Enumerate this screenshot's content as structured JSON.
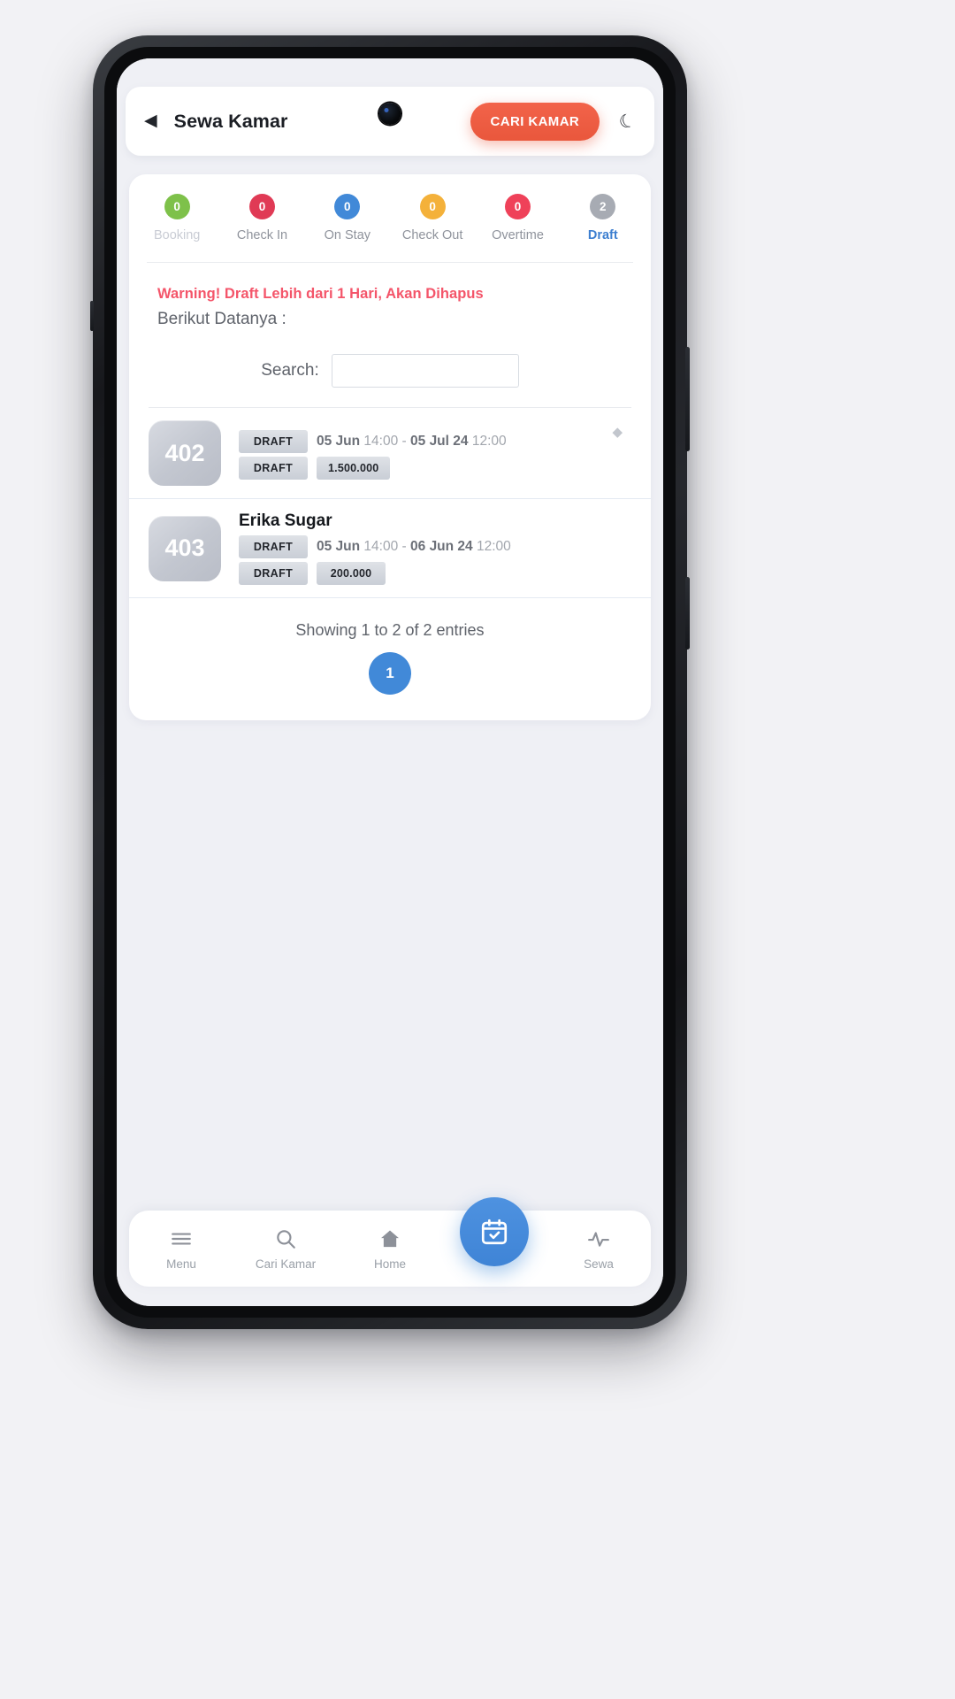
{
  "header": {
    "back_icon": "back-arrow-icon",
    "title": "Sewa Kamar",
    "action_button": "CARI KAMAR",
    "theme_icon": "moon-icon"
  },
  "status_tabs": [
    {
      "label": "Booking",
      "count": "0",
      "color": "#7ec14a",
      "state": "muted"
    },
    {
      "label": "Check In",
      "count": "0",
      "color": "#e03a55",
      "state": "normal"
    },
    {
      "label": "On Stay",
      "count": "0",
      "color": "#4189d8",
      "state": "normal"
    },
    {
      "label": "Check Out",
      "count": "0",
      "color": "#f4b13a",
      "state": "normal"
    },
    {
      "label": "Overtime",
      "count": "0",
      "color": "#ef4159",
      "state": "normal"
    },
    {
      "label": "Draft",
      "count": "2",
      "color": "#a7abb3",
      "state": "active"
    }
  ],
  "notice": {
    "warning": "Warning! Draft Lebih dari 1 Hari, Akan Dihapus",
    "warning_color": "#f4556a",
    "subtitle": "Berikut Datanya :"
  },
  "search": {
    "label": "Search:",
    "value": "",
    "placeholder": ""
  },
  "bookings": [
    {
      "room": "402",
      "guest": "",
      "status_chip": "DRAFT",
      "date_start_day": "05 Jun",
      "date_start_time": "14:00",
      "date_sep": "-",
      "date_end_day": "05 Jul 24",
      "date_end_time": "12:00",
      "payment_chip": "DRAFT",
      "price": "1.500.000"
    },
    {
      "room": "403",
      "guest": "Erika Sugar",
      "status_chip": "DRAFT",
      "date_start_day": "05 Jun",
      "date_start_time": "14:00",
      "date_sep": "-",
      "date_end_day": "06 Jun 24",
      "date_end_time": "12:00",
      "payment_chip": "DRAFT",
      "price": "200.000"
    }
  ],
  "pagination": {
    "entries_text": "Showing 1 to 2 of 2 entries",
    "current_page": "1"
  },
  "bottom_nav": [
    {
      "label": "Menu",
      "icon": "hamburger-menu-icon",
      "active": false
    },
    {
      "label": "Cari Kamar",
      "icon": "search-icon",
      "active": false
    },
    {
      "label": "Home",
      "icon": "home-icon",
      "active": false
    },
    {
      "label": "Jadwal",
      "icon": "calendar-check-icon",
      "active": true
    },
    {
      "label": "Sewa",
      "icon": "activity-pulse-icon",
      "active": false
    }
  ],
  "theme": {
    "accent_orange": "#ec5a3e",
    "accent_blue": "#4189d8",
    "warning_red": "#f4556a"
  }
}
